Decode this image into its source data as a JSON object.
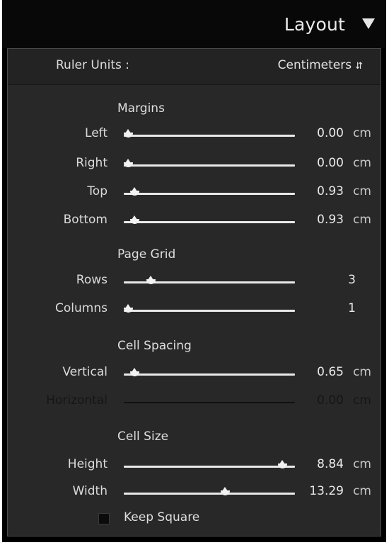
{
  "header": {
    "title": "Layout",
    "collapse_icon": "triangle-down-icon"
  },
  "ruler_units": {
    "label": "Ruler Units :",
    "value": "Centimeters",
    "arrows": "↕"
  },
  "sections": {
    "margins": "Margins",
    "page_grid": "Page Grid",
    "cell_spacing": "Cell Spacing",
    "cell_size": "Cell Size"
  },
  "margins": {
    "left": {
      "label": "Left",
      "value": "0.00",
      "unit": "cm",
      "level": 0.0
    },
    "right": {
      "label": "Right",
      "value": "0.00",
      "unit": "cm",
      "level": 0.0
    },
    "top": {
      "label": "Top",
      "value": "0.93",
      "unit": "cm",
      "level": 0.04
    },
    "bottom": {
      "label": "Bottom",
      "value": "0.93",
      "unit": "cm",
      "level": 0.04
    }
  },
  "page_grid": {
    "rows": {
      "label": "Rows",
      "value": "3",
      "level": 0.14
    },
    "columns": {
      "label": "Columns",
      "value": "1",
      "level": 0.0
    }
  },
  "cell_spacing": {
    "vertical": {
      "label": "Vertical",
      "value": "0.65",
      "unit": "cm",
      "level": 0.04
    },
    "horizontal": {
      "label": "Horizontal",
      "value": "0.00",
      "unit": "cm",
      "disabled": true
    }
  },
  "cell_size": {
    "height": {
      "label": "Height",
      "value": "8.84",
      "unit": "cm",
      "level": 0.95
    },
    "width": {
      "label": "Width",
      "value": "13.29",
      "unit": "cm",
      "level": 0.6
    }
  },
  "keep_square": {
    "label": "Keep Square",
    "checked": false
  }
}
